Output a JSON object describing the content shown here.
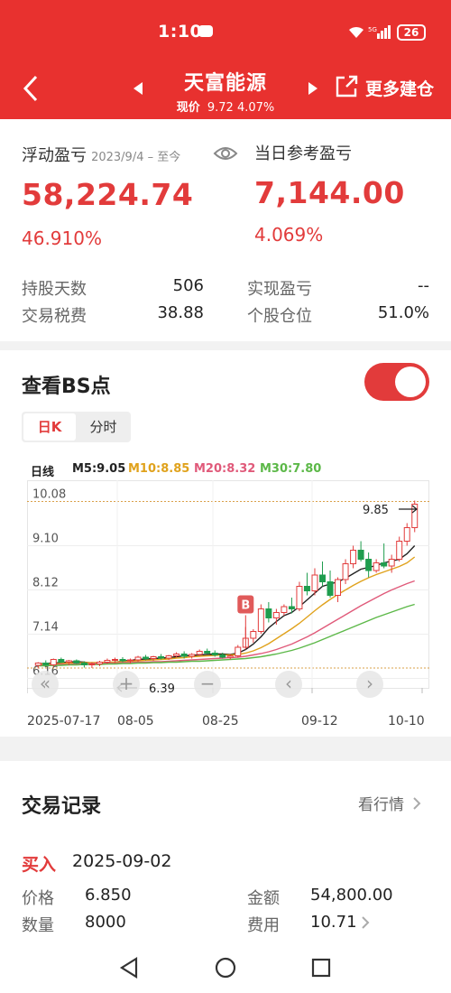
{
  "status": {
    "time": "1:10",
    "battery": "26",
    "signal": "5G"
  },
  "header": {
    "title": "天富能源",
    "price_label": "现价",
    "price": "9.72",
    "change_pct": "4.07%",
    "more_label": "更多建仓"
  },
  "summary": {
    "float_label": "浮动盈亏",
    "float_range": "2023/9/4 – 至今",
    "float_value": "58,224.74",
    "float_pct": "46.910%",
    "daily_label": "当日参考盈亏",
    "daily_value": "7,144.00",
    "daily_pct": "4.069%",
    "rows": [
      {
        "label": "持股天数",
        "value": "506",
        "label2": "实现盈亏",
        "value2": "--"
      },
      {
        "label": "交易税费",
        "value": "38.88",
        "label2": "个股仓位",
        "value2": "51.0%"
      }
    ]
  },
  "bs": {
    "title": "查看BS点",
    "toggle_on": true,
    "tabs": [
      "日K",
      "分时"
    ],
    "ma_labels": [
      "日线",
      "M5:9.05",
      "M10:8.85",
      "M20:8.32",
      "M30:7.80"
    ],
    "ma_colors": [
      "#222222",
      "#222222",
      "#e0a21c",
      "#e05a7a",
      "#5cb848"
    ],
    "marker": "B",
    "controls": [
      "«",
      "+",
      "−",
      "‹",
      "›"
    ]
  },
  "chart_data": {
    "type": "candlestick",
    "y_ticks": [
      "10.08",
      "9.10",
      "8.12",
      "7.14",
      "6.16"
    ],
    "ylim": [
      5.95,
      10.35
    ],
    "x_ticks": [
      "2025-07-17",
      "08-05",
      "08-25",
      "09-12",
      "10-10"
    ],
    "high_label": "9.85",
    "low_label": "6.39",
    "candles": [
      [
        6.45,
        6.52,
        6.38,
        6.5
      ],
      [
        6.5,
        6.56,
        6.44,
        6.46
      ],
      [
        6.46,
        6.6,
        6.42,
        6.58
      ],
      [
        6.58,
        6.62,
        6.5,
        6.52
      ],
      [
        6.52,
        6.57,
        6.45,
        6.55
      ],
      [
        6.55,
        6.58,
        6.48,
        6.5
      ],
      [
        6.5,
        6.54,
        6.4,
        6.46
      ],
      [
        6.46,
        6.52,
        6.39,
        6.48
      ],
      [
        6.48,
        6.55,
        6.43,
        6.52
      ],
      [
        6.52,
        6.6,
        6.48,
        6.56
      ],
      [
        6.56,
        6.62,
        6.5,
        6.58
      ],
      [
        6.58,
        6.63,
        6.52,
        6.55
      ],
      [
        6.55,
        6.6,
        6.49,
        6.57
      ],
      [
        6.57,
        6.66,
        6.53,
        6.63
      ],
      [
        6.63,
        6.68,
        6.56,
        6.6
      ],
      [
        6.6,
        6.66,
        6.55,
        6.64
      ],
      [
        6.64,
        6.7,
        6.58,
        6.61
      ],
      [
        6.61,
        6.68,
        6.57,
        6.66
      ],
      [
        6.66,
        6.74,
        6.62,
        6.7
      ],
      [
        6.7,
        6.76,
        6.6,
        6.65
      ],
      [
        6.65,
        6.72,
        6.6,
        6.69
      ],
      [
        6.69,
        6.8,
        6.66,
        6.76
      ],
      [
        6.76,
        6.82,
        6.7,
        6.72
      ],
      [
        6.72,
        6.78,
        6.64,
        6.68
      ],
      [
        6.68,
        6.73,
        6.6,
        6.63
      ],
      [
        6.63,
        6.7,
        6.58,
        6.66
      ],
      [
        6.66,
        6.9,
        6.62,
        6.85
      ],
      [
        6.85,
        7.3,
        6.8,
        7.05
      ],
      [
        7.05,
        7.25,
        6.95,
        7.2
      ],
      [
        7.2,
        7.8,
        7.15,
        7.7
      ],
      [
        7.7,
        7.85,
        7.4,
        7.5
      ],
      [
        7.5,
        7.7,
        7.35,
        7.62
      ],
      [
        7.62,
        7.8,
        7.55,
        7.75
      ],
      [
        7.75,
        7.95,
        7.6,
        7.7
      ],
      [
        7.7,
        8.3,
        7.65,
        8.2
      ],
      [
        8.2,
        8.5,
        8.0,
        8.1
      ],
      [
        8.1,
        8.6,
        8.0,
        8.45
      ],
      [
        8.45,
        8.75,
        8.2,
        8.3
      ],
      [
        8.3,
        8.55,
        7.95,
        8.0
      ],
      [
        8.0,
        8.4,
        7.85,
        8.35
      ],
      [
        8.35,
        8.8,
        8.25,
        8.7
      ],
      [
        8.7,
        9.1,
        8.6,
        9.0
      ],
      [
        9.0,
        9.2,
        8.75,
        8.8
      ],
      [
        8.8,
        8.95,
        8.4,
        8.55
      ],
      [
        8.55,
        8.8,
        8.5,
        8.72
      ],
      [
        8.72,
        9.15,
        8.6,
        8.65
      ],
      [
        8.65,
        8.9,
        8.5,
        8.8
      ],
      [
        8.8,
        9.3,
        8.75,
        9.2
      ],
      [
        9.2,
        9.6,
        9.1,
        9.5
      ],
      [
        9.5,
        10.1,
        9.4,
        10.02
      ]
    ],
    "ma": {
      "M5": [
        6.48,
        6.49,
        6.5,
        6.51,
        6.52,
        6.53,
        6.52,
        6.5,
        6.5,
        6.51,
        6.52,
        6.54,
        6.56,
        6.58,
        6.59,
        6.6,
        6.61,
        6.62,
        6.64,
        6.66,
        6.67,
        6.68,
        6.69,
        6.7,
        6.7,
        6.69,
        6.72,
        6.8,
        6.92,
        7.08,
        7.28,
        7.42,
        7.55,
        7.62,
        7.75,
        7.9,
        8.05,
        8.2,
        8.25,
        8.3,
        8.38,
        8.48,
        8.58,
        8.62,
        8.66,
        8.72,
        8.76,
        8.8,
        8.92,
        9.1
      ],
      "M10": [
        6.47,
        6.48,
        6.48,
        6.49,
        6.5,
        6.5,
        6.51,
        6.51,
        6.51,
        6.52,
        6.52,
        6.53,
        6.54,
        6.55,
        6.56,
        6.57,
        6.58,
        6.59,
        6.61,
        6.62,
        6.64,
        6.65,
        6.66,
        6.67,
        6.68,
        6.68,
        6.69,
        6.72,
        6.77,
        6.84,
        6.93,
        7.04,
        7.15,
        7.26,
        7.38,
        7.52,
        7.66,
        7.79,
        7.91,
        8.02,
        8.12,
        8.22,
        8.31,
        8.39,
        8.46,
        8.52,
        8.58,
        8.64,
        8.72,
        8.85
      ],
      "M20": [
        6.45,
        6.46,
        6.46,
        6.47,
        6.47,
        6.48,
        6.48,
        6.49,
        6.49,
        6.5,
        6.5,
        6.51,
        6.51,
        6.52,
        6.52,
        6.53,
        6.53,
        6.54,
        6.55,
        6.56,
        6.57,
        6.58,
        6.59,
        6.6,
        6.61,
        6.62,
        6.63,
        6.65,
        6.68,
        6.71,
        6.75,
        6.8,
        6.86,
        6.92,
        7.0,
        7.08,
        7.17,
        7.27,
        7.37,
        7.47,
        7.57,
        7.67,
        7.77,
        7.86,
        7.95,
        8.04,
        8.12,
        8.19,
        8.26,
        8.32
      ],
      "M30": [
        6.44,
        6.44,
        6.45,
        6.45,
        6.46,
        6.46,
        6.47,
        6.47,
        6.47,
        6.48,
        6.48,
        6.49,
        6.49,
        6.5,
        6.5,
        6.51,
        6.51,
        6.52,
        6.52,
        6.53,
        6.54,
        6.54,
        6.55,
        6.56,
        6.57,
        6.58,
        6.59,
        6.6,
        6.62,
        6.64,
        6.67,
        6.7,
        6.74,
        6.78,
        6.83,
        6.89,
        6.95,
        7.02,
        7.09,
        7.16,
        7.23,
        7.3,
        7.37,
        7.44,
        7.51,
        7.57,
        7.63,
        7.69,
        7.75,
        7.8
      ]
    },
    "marker_index": 27
  },
  "trades": {
    "title": "交易记录",
    "link": "看行情",
    "type": "买入",
    "date": "2025-09-02",
    "price_label": "价格",
    "price": "6.850",
    "amount_label": "金额",
    "amount": "54,800.00",
    "qty_label": "数量",
    "qty": "8000",
    "fee_label": "费用",
    "fee": "10.71"
  }
}
